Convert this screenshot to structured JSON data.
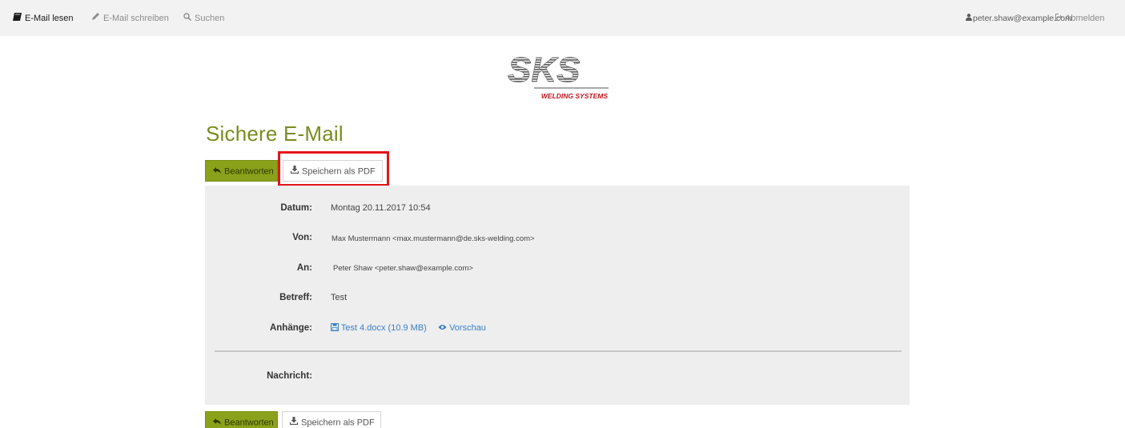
{
  "nav": {
    "read": "E-Mail lesen",
    "write": "E-Mail schreiben",
    "search": "Suchen",
    "user": "peter.shaw@example.com",
    "logout": "Abmelden"
  },
  "logo": {
    "brand": "SKS",
    "tagline": "WELDING SYSTEMS"
  },
  "page": {
    "title": "Sichere E-Mail"
  },
  "actions": {
    "reply": "Beantworten",
    "save_pdf": "Speichern als PDF"
  },
  "mail": {
    "date_label": "Datum:",
    "date_value": "Montag 20.11.2017 10:54",
    "from_label": "Von:",
    "from_value": "Max Mustermann <max.mustermann@de.sks-welding.com>",
    "to_label": "An:",
    "to_value": "Peter Shaw <peter.shaw@example.com>",
    "subject_label": "Betreff:",
    "subject_value": "Test",
    "attachments_label": "Anhänge:",
    "attachment_name": "Test 4.docx (10.9 MB)",
    "preview_label": "Vorschau",
    "message_label": "Nachricht:"
  },
  "colors": {
    "accent_green": "#8aa11b",
    "title_green": "#7a8c1e",
    "link_blue": "#3b7fc4",
    "highlight_red": "#e3151a"
  },
  "icons": {
    "read": "book-icon",
    "write": "pencil-icon",
    "search": "search-icon",
    "user": "user-icon",
    "logout": "logout-icon",
    "reply": "reply-icon",
    "download": "download-icon",
    "file": "file-icon",
    "eye": "eye-icon"
  }
}
